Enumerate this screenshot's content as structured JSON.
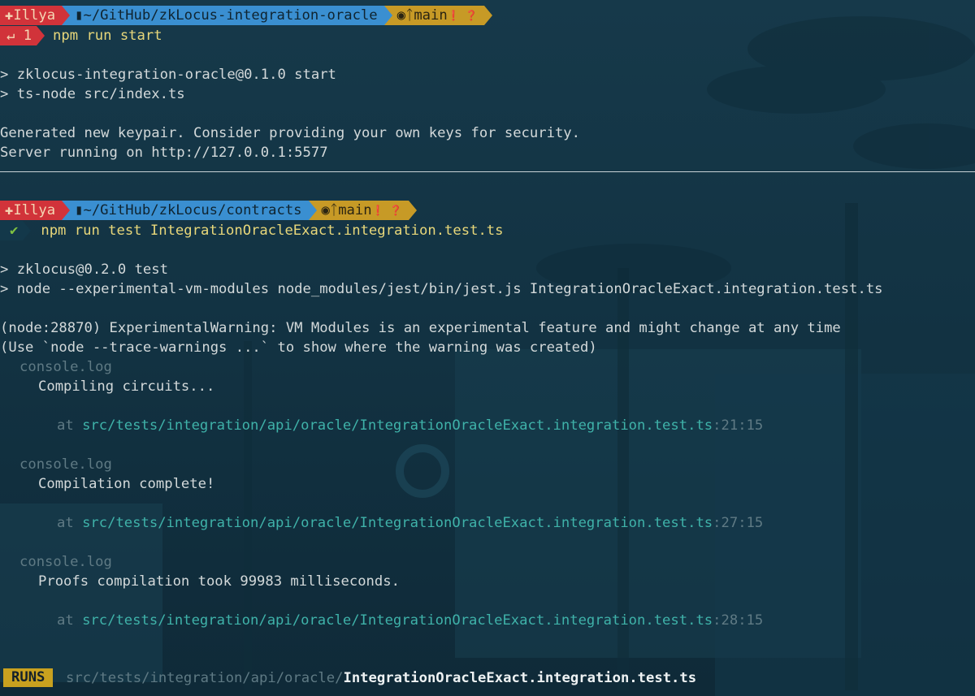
{
  "prompt1": {
    "user": "Illya",
    "dir": "~/GitHub/zkLocus-integration-oracle",
    "git_icon": "octocat-icon",
    "branch_icon": "branch-icon",
    "branch": "main",
    "flags": "❗ ❓",
    "status": "↵ 1",
    "command": "npm run start"
  },
  "block1": {
    "line1": "> zklocus-integration-oracle@0.1.0 start",
    "line2": "> ts-node src/index.ts",
    "line3": "Generated new keypair. Consider providing your own keys for security.",
    "line4": "Server running on http://127.0.0.1:5577"
  },
  "prompt2": {
    "user": "Illya",
    "dir": "~/GitHub/zkLocus/contracts",
    "git_icon": "octocat-icon",
    "branch_icon": "branch-icon",
    "branch": "main",
    "flags": "❗ ❓",
    "status": "✔",
    "command": "npm run test IntegrationOracleExact.integration.test.ts"
  },
  "block2": {
    "line1": "> zklocus@0.2.0 test",
    "line2": "> node --experimental-vm-modules node_modules/jest/bin/jest.js IntegrationOracleExact.integration.test.ts",
    "warn1": "(node:28870) ExperimentalWarning: VM Modules is an experimental feature and might change at any time",
    "warn2": "(Use `node --trace-warnings ...` to show where the warning was created)"
  },
  "logs": [
    {
      "label": "console.log",
      "message": "Compiling circuits...",
      "at": "at",
      "path": "src/tests/integration/api/oracle/IntegrationOracleExact.integration.test.ts",
      "loc": ":21:15"
    },
    {
      "label": "console.log",
      "message": "Compilation complete!",
      "at": "at",
      "path": "src/tests/integration/api/oracle/IntegrationOracleExact.integration.test.ts",
      "loc": ":27:15"
    },
    {
      "label": "console.log",
      "message": "Proofs compilation took 99983 milliseconds.",
      "at": "at",
      "path": "src/tests/integration/api/oracle/IntegrationOracleExact.integration.test.ts",
      "loc": ":28:15"
    }
  ],
  "runs": {
    "badge": "RUNS",
    "dir": "src/tests/integration/api/oracle/",
    "file": "IntegrationOracleExact.integration.test.ts"
  }
}
